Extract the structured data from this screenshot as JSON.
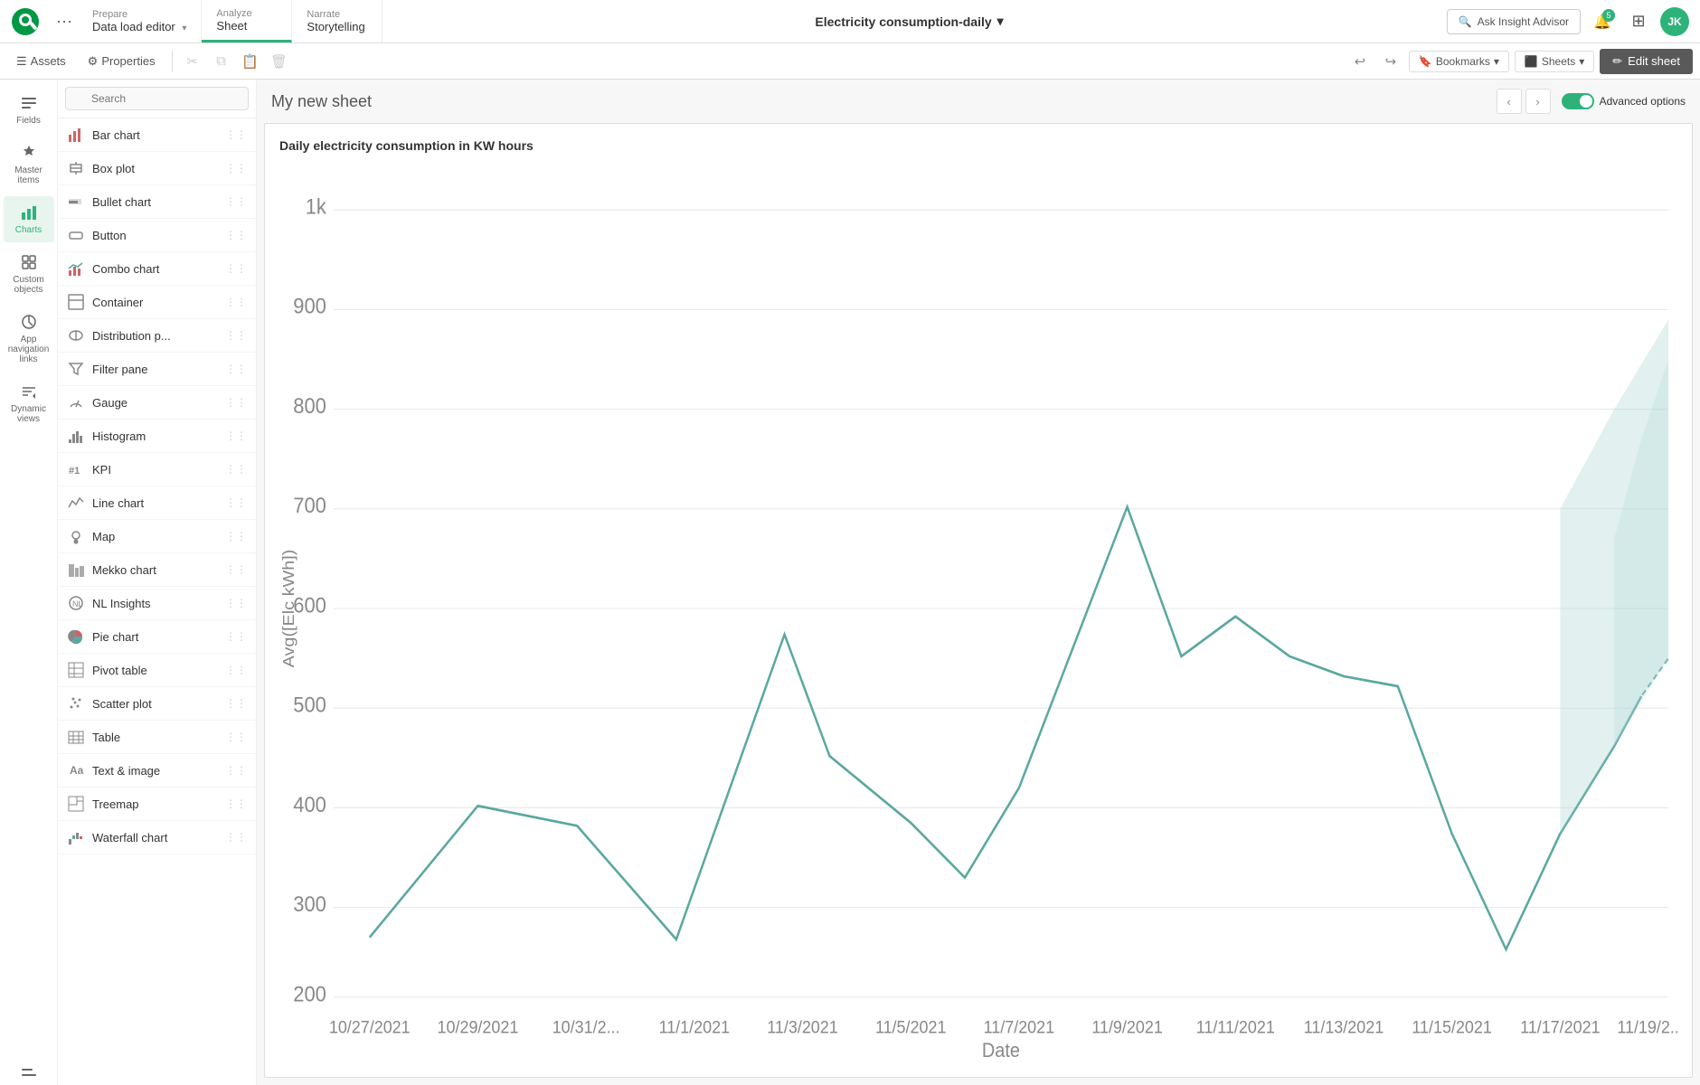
{
  "nav": {
    "prepare_label": "Prepare",
    "prepare_sub": "Data load editor",
    "analyze_label": "Analyze",
    "analyze_sub": "Sheet",
    "narrate_label": "Narrate",
    "narrate_sub": "Storytelling",
    "app_title": "Electricity consumption-daily",
    "insight_placeholder": "Ask Insight Advisor",
    "notification_badge": "5",
    "avatar_initials": "JK"
  },
  "toolbar": {
    "assets_label": "Assets",
    "properties_label": "Properties",
    "undo_title": "Undo",
    "redo_title": "Redo",
    "bookmark_icon": "Bookmark",
    "bookmarks_label": "Bookmarks",
    "sheets_label": "Sheets",
    "edit_sheet_label": "Edit sheet"
  },
  "sidebar": {
    "items": [
      {
        "id": "fields",
        "label": "Fields",
        "icon": "fields"
      },
      {
        "id": "master-items",
        "label": "Master items",
        "icon": "master"
      },
      {
        "id": "charts",
        "label": "Charts",
        "icon": "charts"
      },
      {
        "id": "custom-objects",
        "label": "Custom objects",
        "icon": "custom"
      },
      {
        "id": "app-nav",
        "label": "App navigation links",
        "icon": "nav"
      },
      {
        "id": "dynamic-views",
        "label": "Dynamic views",
        "icon": "dynamic"
      }
    ],
    "bottom_item": "bottom"
  },
  "charts_panel": {
    "search_placeholder": "Search",
    "items": [
      {
        "id": "bar-chart",
        "label": "Bar chart",
        "icon": "bar"
      },
      {
        "id": "box-plot",
        "label": "Box plot",
        "icon": "box"
      },
      {
        "id": "bullet-chart",
        "label": "Bullet chart",
        "icon": "bullet"
      },
      {
        "id": "button",
        "label": "Button",
        "icon": "button"
      },
      {
        "id": "combo-chart",
        "label": "Combo chart",
        "icon": "combo"
      },
      {
        "id": "container",
        "label": "Container",
        "icon": "container"
      },
      {
        "id": "distribution-p",
        "label": "Distribution p...",
        "icon": "dist"
      },
      {
        "id": "filter-pane",
        "label": "Filter pane",
        "icon": "filter"
      },
      {
        "id": "gauge",
        "label": "Gauge",
        "icon": "gauge"
      },
      {
        "id": "histogram",
        "label": "Histogram",
        "icon": "histogram"
      },
      {
        "id": "kpi",
        "label": "KPI",
        "icon": "kpi"
      },
      {
        "id": "line-chart",
        "label": "Line chart",
        "icon": "line"
      },
      {
        "id": "map",
        "label": "Map",
        "icon": "map"
      },
      {
        "id": "mekko-chart",
        "label": "Mekko chart",
        "icon": "mekko"
      },
      {
        "id": "nl-insights",
        "label": "NL Insights",
        "icon": "nl"
      },
      {
        "id": "pie-chart",
        "label": "Pie chart",
        "icon": "pie"
      },
      {
        "id": "pivot-table",
        "label": "Pivot table",
        "icon": "pivot"
      },
      {
        "id": "scatter-plot",
        "label": "Scatter plot",
        "icon": "scatter"
      },
      {
        "id": "table",
        "label": "Table",
        "icon": "table"
      },
      {
        "id": "text-image",
        "label": "Text & image",
        "icon": "text"
      },
      {
        "id": "treemap",
        "label": "Treemap",
        "icon": "treemap"
      },
      {
        "id": "waterfall-chart",
        "label": "Waterfall chart",
        "icon": "waterfall"
      }
    ]
  },
  "sheet": {
    "title": "My new sheet",
    "chart_title": "Daily electricity consumption in KW hours",
    "advanced_options_label": "Advanced options",
    "y_axis_label": "Avg([Elc kWh])",
    "x_axis_label": "Date",
    "y_values": [
      "1k",
      "900",
      "800",
      "700",
      "600",
      "500",
      "400",
      "300",
      "200"
    ],
    "x_values": [
      "10/27/2021",
      "10/29/2021",
      "10/31/2...",
      "11/1/2021",
      "11/3/2021",
      "11/5/2021",
      "11/7/2021",
      "11/9/2021",
      "11/11/2021",
      "11/13/2021",
      "11/15/2021",
      "11/17/2021",
      "11/19/2..."
    ]
  }
}
